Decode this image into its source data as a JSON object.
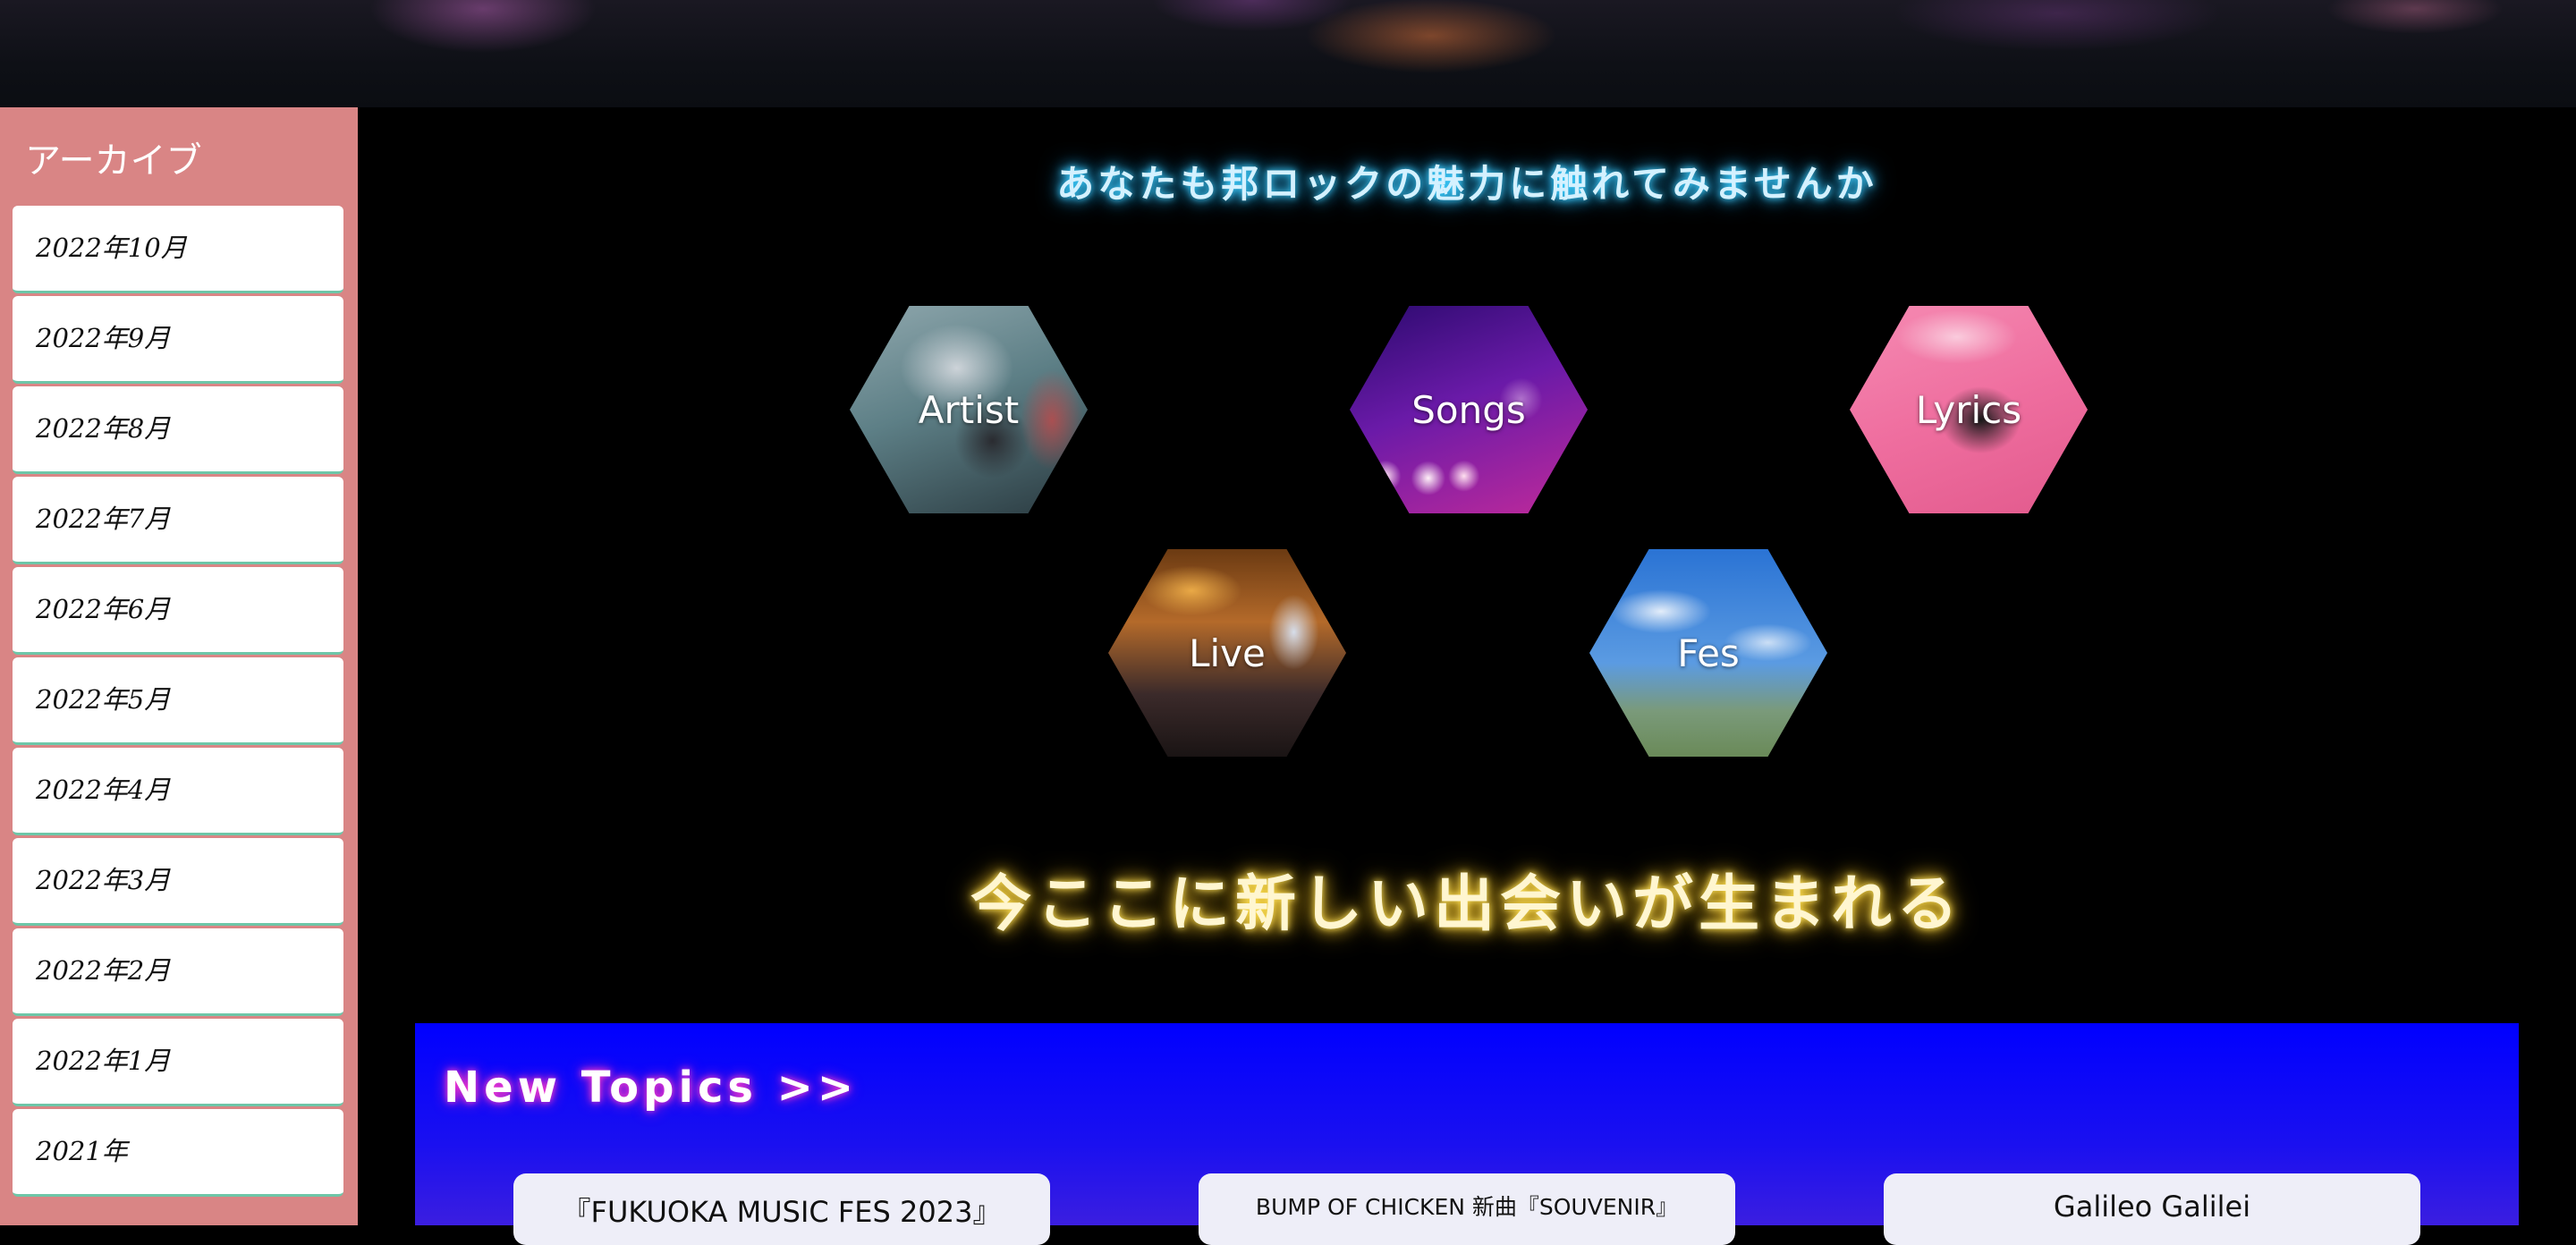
{
  "sidebar": {
    "title": "アーカイブ",
    "items": [
      {
        "label": "2022年10月"
      },
      {
        "label": "2022年9月"
      },
      {
        "label": "2022年8月"
      },
      {
        "label": "2022年7月"
      },
      {
        "label": "2022年6月"
      },
      {
        "label": "2022年5月"
      },
      {
        "label": "2022年4月"
      },
      {
        "label": "2022年3月"
      },
      {
        "label": "2022年2月"
      },
      {
        "label": "2022年1月"
      },
      {
        "label": "2021年"
      }
    ]
  },
  "main": {
    "headline": "あなたも邦ロックの魅力に触れてみませんか",
    "categories": [
      {
        "label": "Artist"
      },
      {
        "label": "Songs"
      },
      {
        "label": "Lyrics"
      },
      {
        "label": "Live"
      },
      {
        "label": "Fes"
      }
    ],
    "tagline": "今ここに新しい出会いが生まれる"
  },
  "topics": {
    "title": "New Topics >>",
    "cards": [
      {
        "title": "『FUKUOKA MUSIC FES 2023』"
      },
      {
        "title": "BUMP OF CHICKEN 新曲『SOUVENIR』"
      },
      {
        "title": "Galileo Galilei"
      }
    ]
  },
  "colors": {
    "sidebar_bg": "#d98585",
    "item_underline": "#6ec6a8",
    "headline_glow": "#3fd0ff",
    "tagline_glow": "#ffe35a",
    "topics_bg": "#0000ff",
    "topics_title_glow": "#ff3fd0"
  }
}
